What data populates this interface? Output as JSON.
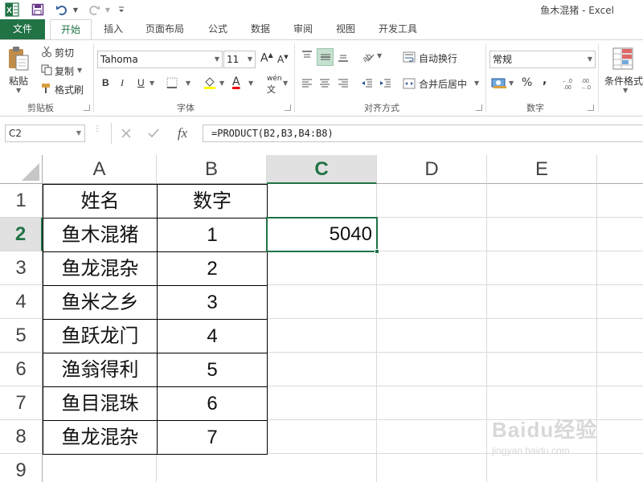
{
  "window": {
    "title": "鱼木混猪 - Excel",
    "app_icon": "excel-logo",
    "accent_color": "#217346"
  },
  "quick_access": {
    "icons": [
      "excel-logo",
      "save-icon",
      "undo-icon",
      "redo-icon",
      "customize-icon"
    ]
  },
  "tabs": [
    {
      "label": "文件"
    },
    {
      "label": "开始"
    },
    {
      "label": "插入"
    },
    {
      "label": "页面布局"
    },
    {
      "label": "公式"
    },
    {
      "label": "数据"
    },
    {
      "label": "审阅"
    },
    {
      "label": "视图"
    },
    {
      "label": "开发工具"
    }
  ],
  "ribbon": {
    "clipboard": {
      "group_label": "剪贴板",
      "paste": "粘贴",
      "cut": "剪切",
      "copy": "复制",
      "format_painter": "格式刷"
    },
    "font": {
      "group_label": "字体",
      "font_name": "Tahoma",
      "font_size": "11",
      "grow": "A",
      "shrink": "A",
      "bold": "B",
      "italic": "I",
      "underline": "U",
      "font_color_letter": "A",
      "phonetic_label": "wén"
    },
    "alignment": {
      "group_label": "对齐方式",
      "wrap_text": "自动换行",
      "merge_center": "合并后居中"
    },
    "number": {
      "group_label": "数字",
      "format": "常规",
      "percent": "%",
      "comma": ","
    },
    "styles": {
      "conditional": "条件格式"
    }
  },
  "formula_bar": {
    "name_box": "C2",
    "formula": "=PRODUCT(B2,B3,B4:B8)",
    "fx": "fx"
  },
  "sheet": {
    "columns": [
      "A",
      "B",
      "C",
      "D",
      "E"
    ],
    "selected_column": "C",
    "rows": [
      "1",
      "2",
      "3",
      "4",
      "5",
      "6",
      "7",
      "8",
      "9"
    ],
    "selected_row": "2",
    "headers": {
      "name": "姓名",
      "number": "数字"
    },
    "data": [
      {
        "name": "鱼木混猪",
        "number": "1"
      },
      {
        "name": "鱼龙混杂",
        "number": "2"
      },
      {
        "name": "鱼米之乡",
        "number": "3"
      },
      {
        "name": "鱼跃龙门",
        "number": "4"
      },
      {
        "name": "渔翁得利",
        "number": "5"
      },
      {
        "name": "鱼目混珠",
        "number": "6"
      },
      {
        "name": "鱼龙混杂",
        "number": "7"
      }
    ],
    "active_cell_value": "5040"
  },
  "watermark": {
    "brand": "Baidu经验",
    "url": "jingyan.baidu.com"
  }
}
